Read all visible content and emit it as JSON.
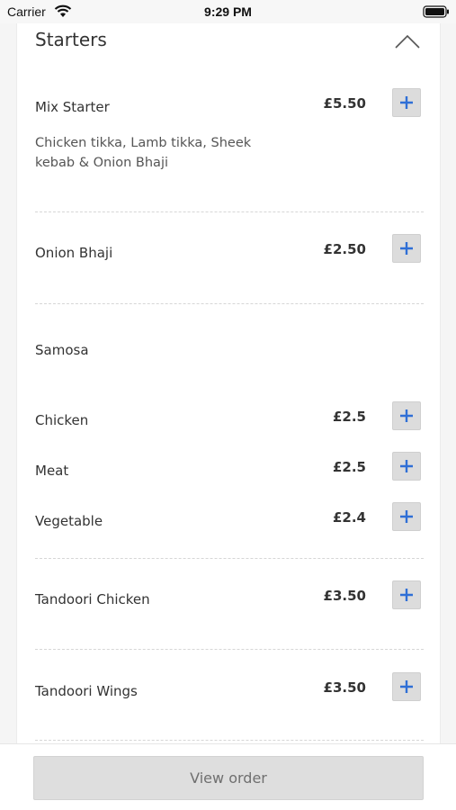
{
  "status_bar": {
    "carrier": "Carrier",
    "time": "9:29 PM",
    "icons": [
      "wifi-icon",
      "battery-icon"
    ]
  },
  "section": {
    "title": "Starters",
    "toggle_icon": "chevron-up-icon"
  },
  "items": [
    {
      "name": "Mix Starter",
      "price": "£5.50",
      "description_line1": "Chicken tikka, Lamb tikka, Sheek",
      "description_line2": "kebab & Onion Bhaji"
    },
    {
      "name": "Onion Bhaji",
      "price": "£2.50"
    }
  ],
  "samosa": {
    "group_name": "Samosa",
    "options": [
      {
        "name": "Chicken",
        "price": "£2.5"
      },
      {
        "name": "Meat",
        "price": "£2.5"
      },
      {
        "name": "Vegetable",
        "price": "£2.4"
      }
    ]
  },
  "more_items": [
    {
      "name": "Tandoori Chicken",
      "price": "£3.50"
    },
    {
      "name": "Tandoori Wings",
      "price": "£3.50"
    }
  ],
  "add_icon": "plus-icon",
  "accent_color": "#2f6fd6",
  "footer": {
    "view_order_label": "View order"
  }
}
